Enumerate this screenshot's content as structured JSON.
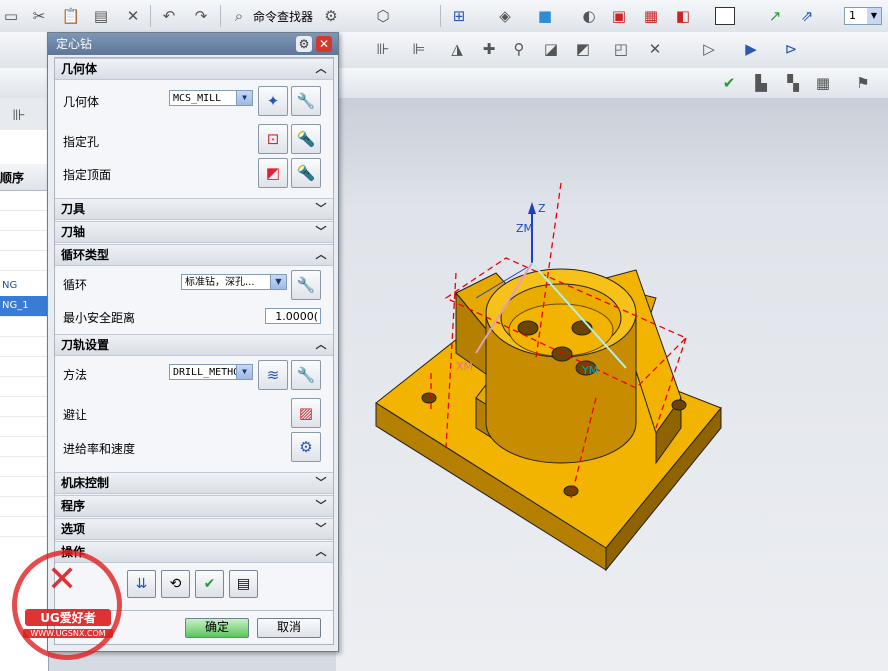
{
  "toolbar": {
    "command_finder": "命令查找器",
    "layer_value": "1"
  },
  "navigator": {
    "header_fragment": "序顺序",
    "rows": [
      "NG",
      "NG_1"
    ]
  },
  "dialog": {
    "title": "定心钻",
    "sections": {
      "geometry": "几何体",
      "tool": "刀具",
      "tool_axis": "刀轴",
      "cycle_type": "循环类型",
      "path_settings": "刀轨设置",
      "machine_control": "机床控制",
      "program": "程序",
      "options": "选项",
      "actions": "操作"
    },
    "geometry": {
      "geometry_label": "几何体",
      "geometry_value": "MCS_MILL",
      "specify_holes_label": "指定孔",
      "specify_top_label": "指定顶面"
    },
    "cycle": {
      "cycle_label": "循环",
      "cycle_value": "标准钻，深孔...",
      "min_clearance_label": "最小安全距离",
      "min_clearance_value": "1.0000("
    },
    "path": {
      "method_label": "方法",
      "method_value": "DRILL_METHO",
      "avoid_label": "避让",
      "feeds_label": "进给率和速度"
    },
    "buttons": {
      "ok": "确定",
      "cancel": "取消"
    }
  },
  "viewport": {
    "axis_zm": "ZM",
    "axis_z": "Z",
    "axis_xm": "XM",
    "axis_ym": "YM",
    "part_color": "#f2b400"
  },
  "watermark": {
    "brand": "UG爱好者",
    "url": "WWW.UGSNX.COM"
  }
}
